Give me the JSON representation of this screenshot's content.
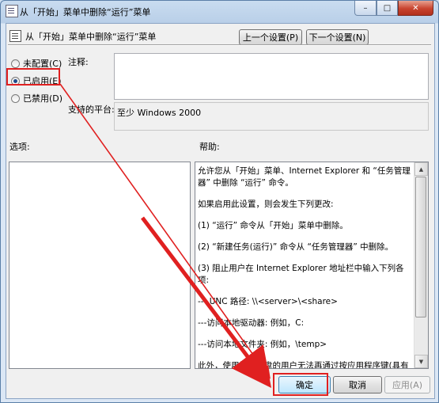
{
  "window": {
    "title": "从「开始」菜单中删除“运行”菜单"
  },
  "caption": {
    "minimize": "–",
    "maximize": "□",
    "close": "✕"
  },
  "header": {
    "title": "从「开始」菜单中删除“运行”菜单",
    "prev_button": "上一个设置(P)",
    "next_button": "下一个设置(N)"
  },
  "options": [
    {
      "label": "未配置(C)",
      "checked": false
    },
    {
      "label": "已启用(E)",
      "checked": true
    },
    {
      "label": "已禁用(D)",
      "checked": false
    }
  ],
  "comment": {
    "label": "注释:",
    "value": ""
  },
  "platform": {
    "label": "支持的平台:",
    "value": "至少 Windows 2000"
  },
  "options_section": {
    "label": "选项:"
  },
  "help": {
    "label": "帮助:",
    "paragraphs": [
      "允许您从「开始」菜单、Internet Explorer 和 “任务管理器” 中删除 “运行” 命令。",
      "如果启用此设置，则会发生下列更改:",
      "(1) “运行” 命令从「开始」菜单中删除。",
      "(2) “新建任务(运行)” 命令从 “任务管理器” 中删除。",
      "(3) 阻止用户在 Internet Explorer 地址栏中输入下列各项:",
      "--- UNC 路径: \\\\<server>\\<share>",
      "---访问本地驱动器: 例如，C:",
      "---访问本地文件夹: 例如，\\temp>",
      "此外，使用扩展键盘的用户无法再通过按应用程序键(具有 Windows 徽标的键)+ R 来显示 “运行” 对话框。"
    ]
  },
  "footer": {
    "ok": "确定",
    "cancel": "取消",
    "apply": "应用(A)"
  },
  "annotation_color": "#e02020"
}
